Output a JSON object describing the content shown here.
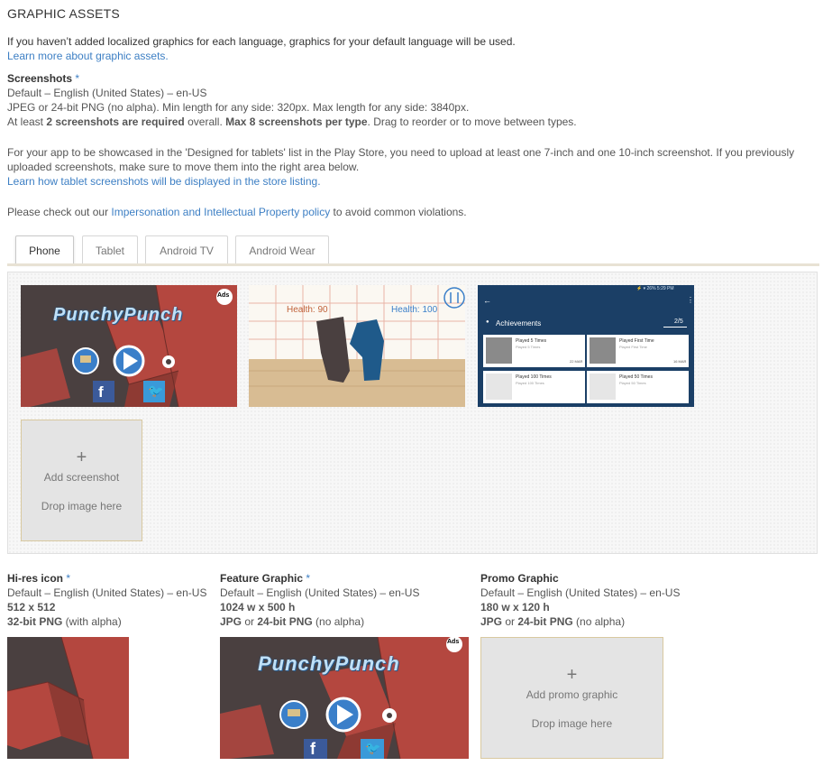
{
  "section_title": "GRAPHIC ASSETS",
  "intro": {
    "text": "If you haven’t added localized graphics for each language, graphics for your default language will be used.",
    "link": "Learn more about graphic assets."
  },
  "screenshots": {
    "heading": "Screenshots",
    "required_mark": "*",
    "language": "Default – English (United States) – en-US",
    "format": "JPEG or 24-bit PNG (no alpha). Min length for any side: 320px. Max length for any side: 3840px.",
    "rule_prefix": "At least ",
    "rule_bold1": "2 screenshots are required",
    "rule_mid": " overall. ",
    "rule_bold2": "Max 8 screenshots per type",
    "rule_suffix": ". Drag to reorder or to move between types.",
    "tablet_text1": "For your app to be showcased in the 'Designed for tablets' list in the Play Store, you need to upload at least one 7-inch and one 10-inch screenshot. If you previously",
    "tablet_text2": "uploaded screenshots, make sure to move them into the right area below.",
    "tablet_link": "Learn how tablet screenshots will be displayed in the store listing.",
    "policy_prefix": "Please check out our ",
    "policy_link": "Impersonation and Intellectual Property policy",
    "policy_suffix": " to avoid common violations."
  },
  "tabs": [
    {
      "label": "Phone",
      "active": true
    },
    {
      "label": "Tablet",
      "active": false
    },
    {
      "label": "Android TV",
      "active": false
    },
    {
      "label": "Android Wear",
      "active": false
    }
  ],
  "thumbs": {
    "game_title": "PunchyPunch",
    "ads_badge": "Ads",
    "health_left": "Health: 90",
    "health_right": "Health: 100",
    "status_bar": "⚡ ▾ 26% 5:29 PM",
    "achievements_title": "Achievements",
    "achievements_count": "2/5",
    "achievements": [
      {
        "title": "Played 5 Times",
        "sub": "Played 5 Times",
        "date": "22 MAR",
        "unlocked": true
      },
      {
        "title": "Played First Time",
        "sub": "Played First Time",
        "date": "16 MAR",
        "unlocked": true
      },
      {
        "title": "Played 100 Times",
        "sub": "Played 100 Times",
        "date": "",
        "unlocked": false
      },
      {
        "title": "Played 50 Times",
        "sub": "Played 50 Times",
        "date": "",
        "unlocked": false
      }
    ]
  },
  "add_screenshot": {
    "plus": "+",
    "label": "Add screenshot",
    "drop": "Drop image here"
  },
  "hires_icon": {
    "heading": "Hi-res icon",
    "required_mark": "*",
    "language": "Default – English (United States) – en-US",
    "size": "512 x 512",
    "format_bold": "32-bit PNG",
    "format_rest": " (with alpha)"
  },
  "feature_graphic": {
    "heading": "Feature Graphic",
    "required_mark": "*",
    "language": "Default – English (United States) – en-US",
    "size": "1024 w x 500 h",
    "format_bold1": "JPG",
    "format_mid": " or ",
    "format_bold2": "24-bit PNG",
    "format_rest": " (no alpha)"
  },
  "promo_graphic": {
    "heading": "Promo Graphic",
    "language": "Default – English (United States) – en-US",
    "size": "180 w x 120 h",
    "format_bold1": "JPG",
    "format_mid": " or ",
    "format_bold2": "24-bit PNG",
    "format_rest": " (no alpha)",
    "plus": "+",
    "label": "Add promo graphic",
    "drop": "Drop image here"
  },
  "colors": {
    "link": "#3d7fc4",
    "game_red": "#b4473f",
    "game_dark": "#4a4040",
    "achievement_bg": "#1b3f66"
  }
}
